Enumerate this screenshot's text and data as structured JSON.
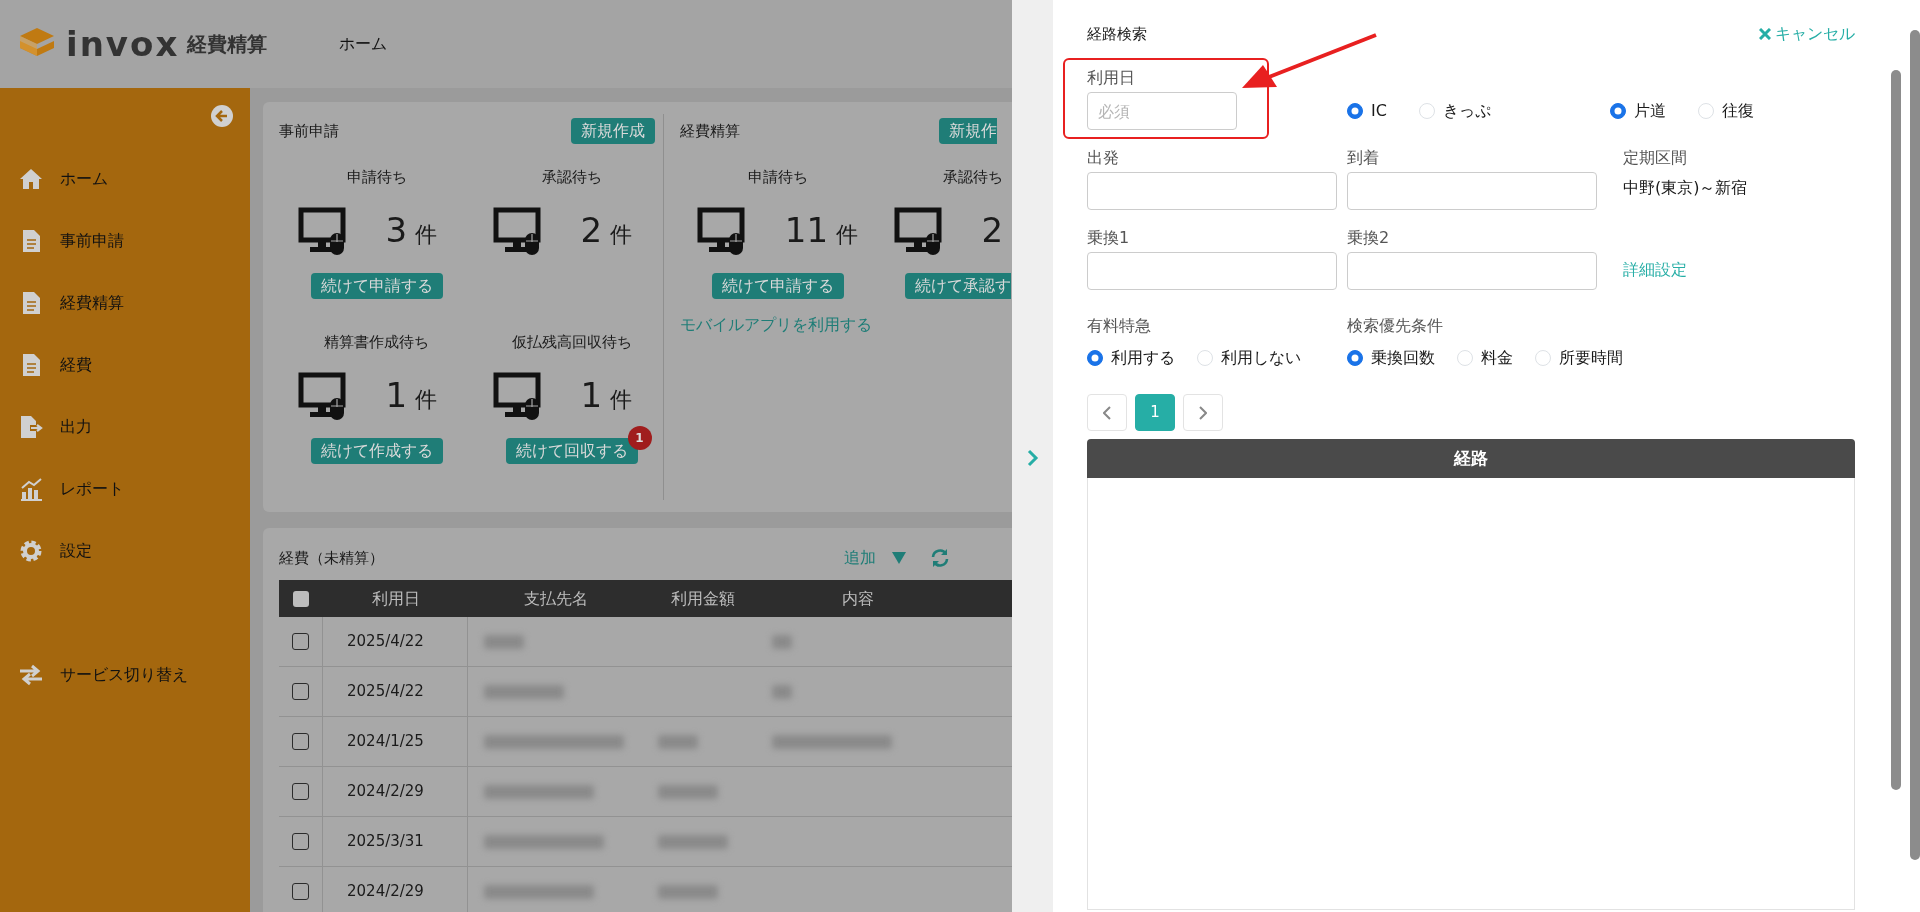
{
  "header": {
    "logo_text": "invox",
    "logo_subtitle": "経費精算",
    "nav": "ホーム"
  },
  "sidebar": {
    "items": [
      {
        "label": "ホーム"
      },
      {
        "label": "事前申請"
      },
      {
        "label": "経費精算"
      },
      {
        "label": "経費"
      },
      {
        "label": "出力"
      },
      {
        "label": "レポート"
      },
      {
        "label": "設定"
      }
    ],
    "footer_items": [
      {
        "label": "サービス切り替え"
      }
    ]
  },
  "dashboard": {
    "sections": [
      {
        "title": "事前申請",
        "action": "新規作成",
        "stats": [
          {
            "label": "申請待ち",
            "count": "3",
            "unit": "件",
            "button": "続けて申請する"
          },
          {
            "label": "承認待ち",
            "count": "2",
            "unit": "件"
          },
          {
            "label": "精算書作成待ち",
            "count": "1",
            "unit": "件",
            "button": "続けて作成する"
          },
          {
            "label": "仮払残高回収待ち",
            "count": "1",
            "unit": "件",
            "button": "続けて回収する",
            "badge": "1"
          }
        ]
      },
      {
        "title": "経費精算",
        "action": "新規作",
        "stats": [
          {
            "label": "申請待ち",
            "count": "11",
            "unit": "件",
            "button": "続けて申請する"
          },
          {
            "label": "承認待ち",
            "count": "2",
            "button": "続けて承認す"
          }
        ],
        "link": "モバイルアプリを利用する"
      }
    ]
  },
  "expenses": {
    "title": "経費（未精算）",
    "add": "追加",
    "select_all": {
      "checked": false
    },
    "columns": [
      "利用日",
      "支払先名",
      "利用金額",
      "内容"
    ],
    "rows": [
      {
        "date": "2025/4/22",
        "checked": false
      },
      {
        "date": "2025/4/22",
        "checked": false
      },
      {
        "date": "2024/1/25",
        "checked": false
      },
      {
        "date": "2024/2/29",
        "checked": false
      },
      {
        "date": "2025/3/31",
        "checked": false
      },
      {
        "date": "2024/2/29",
        "checked": false
      }
    ]
  },
  "route_panel": {
    "title": "経路検索",
    "cancel": "キャンセル",
    "date": {
      "label": "利用日",
      "placeholder": "必須"
    },
    "fare_type": [
      {
        "label": "IC",
        "selected": true
      },
      {
        "label": "きっぷ",
        "selected": false
      }
    ],
    "trip": [
      {
        "label": "片道",
        "selected": true
      },
      {
        "label": "往復",
        "selected": false
      }
    ],
    "fields": [
      {
        "label": "出発"
      },
      {
        "label": "到着"
      },
      {
        "label": "乗換1"
      },
      {
        "label": "乗換2"
      }
    ],
    "commuter": {
      "label": "定期区間",
      "value": "中野(東京)～新宿"
    },
    "advanced_link": "詳細設定",
    "express": {
      "label": "有料特急",
      "options": [
        {
          "label": "利用する",
          "selected": true
        },
        {
          "label": "利用しない",
          "selected": false
        }
      ]
    },
    "priority": {
      "label": "検索優先条件",
      "options": [
        {
          "label": "乗換回数",
          "selected": true
        },
        {
          "label": "料金",
          "selected": false
        },
        {
          "label": "所要時間",
          "selected": false
        }
      ]
    },
    "pagination": {
      "pages": [
        {
          "label": "1",
          "selected": true
        }
      ]
    },
    "results": {
      "header": "経路"
    }
  }
}
